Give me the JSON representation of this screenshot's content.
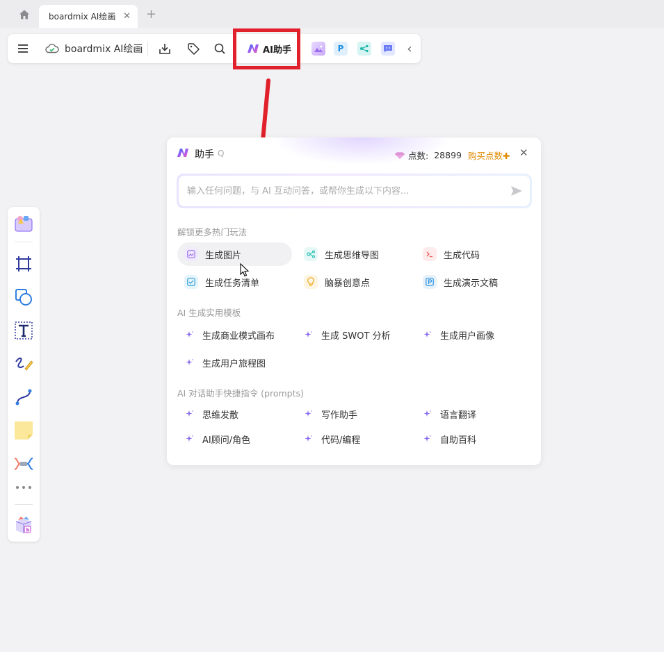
{
  "tab": {
    "title": "boardmix AI绘画",
    "close": "✕",
    "new": "+"
  },
  "toolbar": {
    "doc_title": "boardmix AI绘画",
    "ai_button_label": "AI助手",
    "collapse": "‹"
  },
  "apps": [
    {
      "icon": "image-generator-icon",
      "color": "#b58cf5"
    },
    {
      "icon": "presentation-p-icon",
      "color": "#2f9be8",
      "letter": "P"
    },
    {
      "icon": "mindmap-icon",
      "color": "#22c3b8"
    },
    {
      "icon": "chat-icon",
      "color": "#6b7cf5"
    }
  ],
  "panel": {
    "title": "助手",
    "title_suffix": "Q",
    "points_label": "点数:",
    "points_value": "28899",
    "buy_label": "购买点数✚",
    "close": "✕",
    "input_placeholder": "输入任何问题，与 AI 互动问答，或帮你生成以下内容...",
    "section_features": "解锁更多热门玩法",
    "features": [
      {
        "label": "生成图片",
        "icon": "image-icon",
        "color": "#9b6cf0",
        "bg": "#f1ebfe"
      },
      {
        "label": "生成思维导图",
        "icon": "mindmap-icon",
        "color": "#22bfb2",
        "bg": "#e6f8f6"
      },
      {
        "label": "生成代码",
        "icon": "code-icon",
        "color": "#ef5a5a",
        "bg": "#fdeceb"
      },
      {
        "label": "生成任务清单",
        "icon": "checklist-icon",
        "color": "#2aa0d8",
        "bg": "#e6f4fb"
      },
      {
        "label": "脑暴创意点",
        "icon": "lightbulb-icon",
        "color": "#f2a91f",
        "bg": "#fdf4e2"
      },
      {
        "label": "生成演示文稿",
        "icon": "presentation-icon",
        "color": "#2a92e0",
        "bg": "#e6f1fb"
      }
    ],
    "section_templates": "AI 生成实用模板",
    "templates": [
      "生成商业模式画布",
      "生成 SWOT 分析",
      "生成用户画像",
      "生成用户旅程图"
    ],
    "section_prompts": "AI 对话助手快捷指令 (prompts)",
    "prompts": [
      "思维发散",
      "写作助手",
      "语言翻译",
      "AI顾问/角色",
      "代码/编程",
      "自助百科"
    ]
  },
  "colors": {
    "highlight": "#e0202a",
    "accent": "#7b5cf5",
    "buy": "#e08a00"
  }
}
